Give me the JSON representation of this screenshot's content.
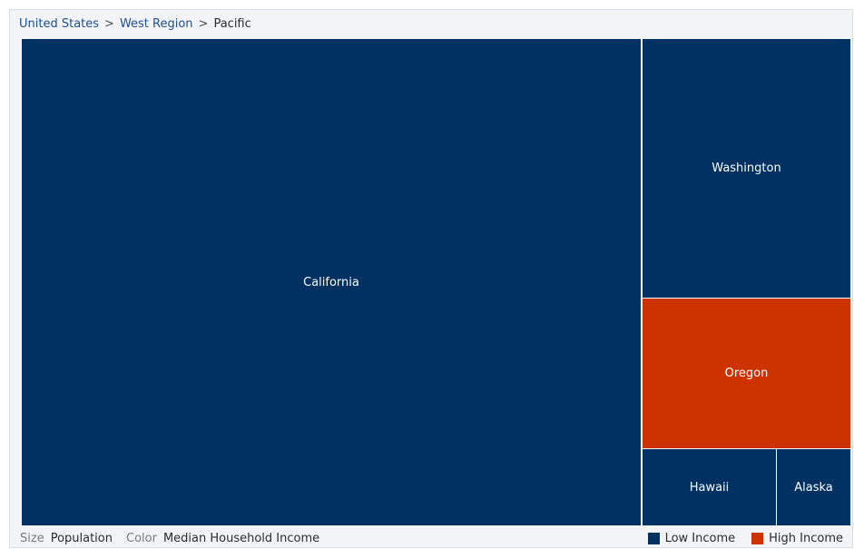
{
  "breadcrumb": {
    "items": [
      "United States",
      "West Region",
      "Pacific"
    ],
    "separator": ">"
  },
  "footer": {
    "size_key": "Size",
    "size_value": "Population",
    "color_key": "Color",
    "color_value": "Median Household Income"
  },
  "legend": {
    "items": [
      {
        "label": "Low Income",
        "color": "#003163"
      },
      {
        "label": "High Income",
        "color": "#cc3300"
      }
    ]
  },
  "tiles": [
    {
      "label": "California",
      "category": "Low Income"
    },
    {
      "label": "Washington",
      "category": "Low Income"
    },
    {
      "label": "Oregon",
      "category": "High Income"
    },
    {
      "label": "Hawaii",
      "category": "Low Income"
    },
    {
      "label": "Alaska",
      "category": "Low Income"
    }
  ]
}
